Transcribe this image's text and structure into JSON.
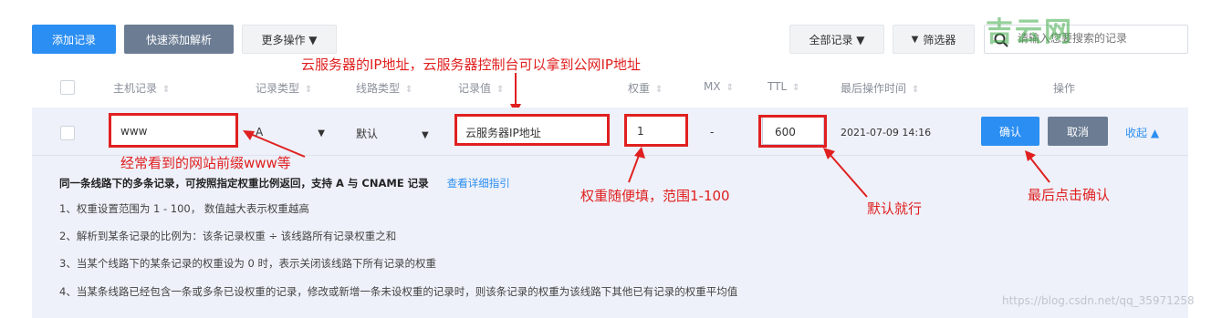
{
  "toolbar": {
    "add_record": "添加记录",
    "quick_add": "快速添加解析",
    "more_actions": "更多操作 ▼",
    "all_records": "全部记录 ▼",
    "filter": "筛选器",
    "search_placeholder": "请输入您要搜索的记录"
  },
  "watermark_logo": "吉云网",
  "headers": [
    "主机记录",
    "记录类型",
    "线路类型",
    "记录值",
    "权重",
    "MX",
    "TTL",
    "最后操作时间",
    "操作"
  ],
  "row": {
    "host": "www",
    "type": "A",
    "line": "默认",
    "value": "云服务器IP地址",
    "weight": "1",
    "mx": "-",
    "ttl": "600",
    "time": "2021-07-09 14:16",
    "confirm": "确认",
    "cancel": "取消",
    "collapse": "收起 ▲"
  },
  "info": {
    "title": "同一条线路下的多条记录，可按照指定权重比例返回，支持 A 与 CNAME 记录",
    "link": "查看详细指引",
    "lines": [
      "1、权重设置范围为 1 - 100， 数值越大表示权重越高",
      "2、解析到某条记录的比例为：该条记录权重 ÷ 该线路所有记录权重之和",
      "3、当某个线路下的某条记录的权重设为 0 时，表示关闭该线路下所有记录的权重",
      "4、当某条线路已经包含一条或多条已设权重的记录，修改或新增一条未设权重的记录时，则该条记录的权重为该线路下其他已有记录的权重平均值"
    ]
  },
  "annotations": {
    "ip_note": "云服务器的IP地址，云服务器控制台可以拿到公网IP地址",
    "prefix_note": "经常看到的网站前缀www等",
    "weight_note": "权重随便填，范围1-100",
    "ttl_note": "默认就行",
    "confirm_note": "最后点击确认"
  },
  "watermark_url": "https://blog.csdn.net/qq_35971258",
  "colors": {
    "accent": "#2b8ef2",
    "annotation": "#e02020",
    "panel": "#eef1f9"
  }
}
